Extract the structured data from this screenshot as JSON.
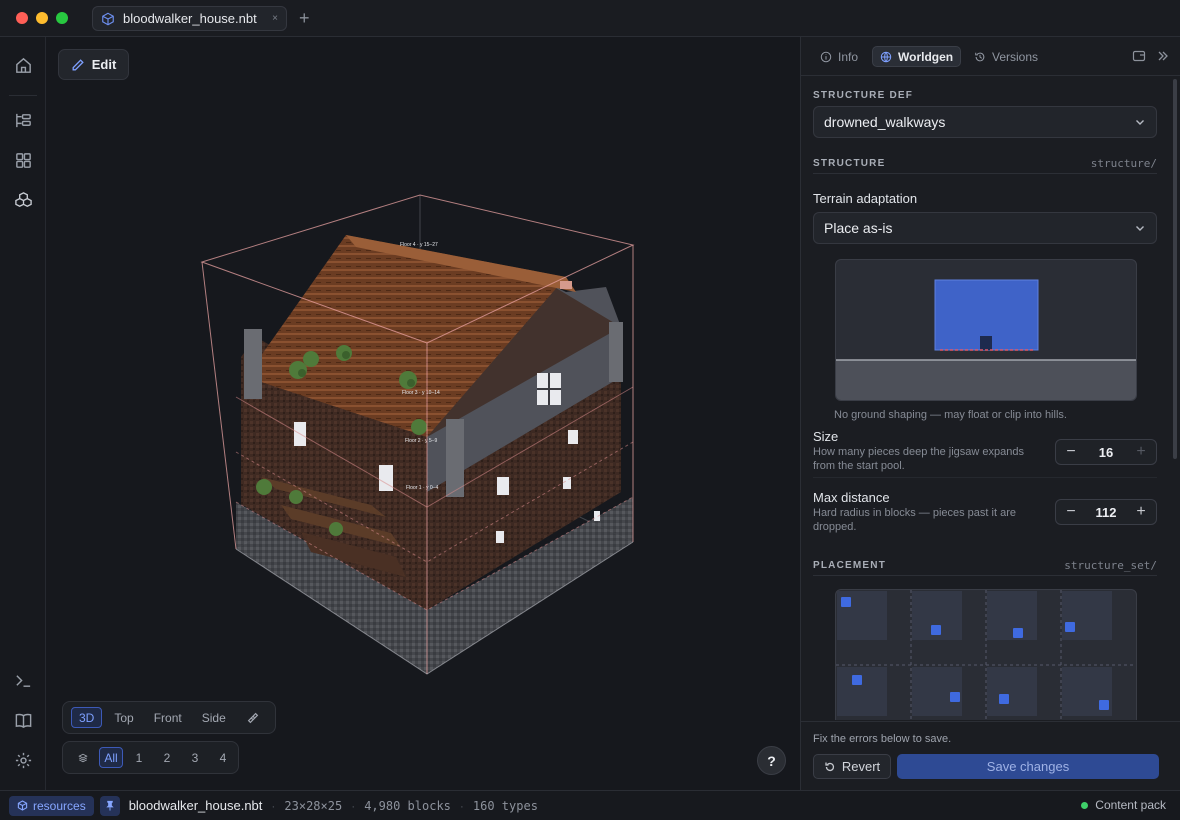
{
  "window": {
    "tab_title": "bloodwalker_house.nbt",
    "tab_close": "×",
    "new_tab": "+"
  },
  "viewport": {
    "edit_label": "Edit",
    "floor_labels": [
      "Floor 4 · y 15–27",
      "Floor 3 · y 10–14",
      "Floor 2 · y 5–9",
      "Floor 1 · y 0–4"
    ],
    "view_modes": [
      "3D",
      "Top",
      "Front",
      "Side"
    ],
    "active_view": "3D",
    "layers": [
      "All",
      "1",
      "2",
      "3",
      "4"
    ],
    "active_layer": "All",
    "help_label": "?"
  },
  "panel": {
    "tabs": [
      {
        "label": "Info",
        "icon": "info-icon"
      },
      {
        "label": "Worldgen",
        "icon": "globe-icon"
      },
      {
        "label": "Versions",
        "icon": "history-icon"
      }
    ],
    "active_tab": "Worldgen",
    "structure_def": {
      "label": "STRUCTURE DEF",
      "value": "drowned_walkways"
    },
    "structure": {
      "label": "STRUCTURE",
      "path": "structure/",
      "terrain_label": "Terrain adaptation",
      "terrain_value": "Place as-is",
      "terrain_help": "No ground shaping — may float or clip into hills.",
      "size_label": "Size",
      "size_help": "How many pieces deep the jigsaw expands from the start pool.",
      "size_value": "16",
      "max_distance_label": "Max distance",
      "max_distance_help": "Hard radius in blocks — pieces past it are dropped.",
      "max_distance_value": "112",
      "minus": "−",
      "plus": "+"
    },
    "placement": {
      "label": "PLACEMENT",
      "path": "structure_set/"
    },
    "footer": {
      "message": "Fix the errors below to save.",
      "revert_label": "Revert",
      "save_label": "Save changes"
    }
  },
  "statusbar": {
    "pack_label": "resources",
    "file": "bloodwalker_house.nbt",
    "dimensions": "23×28×25",
    "blocks": "4,980 blocks",
    "types": "160 types",
    "separator": "·",
    "content_pack": "Content pack"
  },
  "colors": {
    "accent": "#3d5ab8",
    "status_ok": "#3fcf6a",
    "preview_blue": "#3f63c8"
  }
}
